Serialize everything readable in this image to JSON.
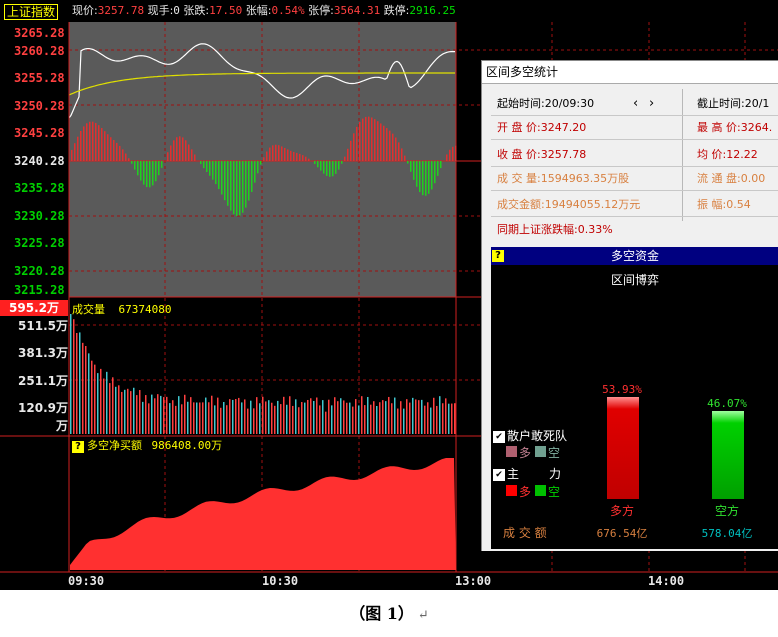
{
  "topbar": {
    "index_name": "上证指数",
    "now_label": "现价:",
    "now_value": "3257.78",
    "hand_label": "现手:",
    "hand_value": "0",
    "change_label": "张跌:",
    "change_value": "17.50",
    "pct_label": "张幅:",
    "pct_value": "0.54%",
    "limit_up_label": "张停:",
    "limit_up_value": "3564.31",
    "limit_down_label": "跌停:",
    "limit_down_value": "2916.25"
  },
  "price_axis": {
    "red_labels": [
      "3265.28",
      "3260.28",
      "3255.28",
      "3250.28",
      "3245.28"
    ],
    "mid_label": "3240.28",
    "green_labels": [
      "3235.28",
      "3230.28",
      "3225.28",
      "3220.28",
      "3215.28"
    ]
  },
  "volume": {
    "max_label": "595.2万",
    "title": "成交量",
    "value": "67374080",
    "axis_labels": [
      "511.5万",
      "381.3万",
      "251.1万",
      "120.9万",
      "万"
    ]
  },
  "net_buy": {
    "title": "多空净买额",
    "value": "986408.00万"
  },
  "time_axis": [
    "09:30",
    "10:30",
    "13:00",
    "14:00"
  ],
  "popup": {
    "title": "区间多空统计",
    "start_label": "起始时间:20/09:30",
    "nav_prev": "‹",
    "nav_next": "›",
    "end_label": "截止时间:20/1",
    "open_label": "开 盘 价:3247.20",
    "high_label": "最 高 价:3264.",
    "close_label": "收 盘 价:3257.78",
    "avg_label": "均    价:12.22",
    "volume_label": "成 交 量:1594963.35万股",
    "float_label": "流 通 盘:0.00",
    "amount_label": "成交金额:19494055.12万元",
    "amplitude_label": "振    幅:0.54",
    "period_change": "同期上证涨跌幅:0.33%",
    "panel": {
      "header": "多空资金",
      "subtitle": "区间博弈",
      "legend_retail": "散户敢死队",
      "legend_main": "主",
      "legend_main_power": "力",
      "duo": "多",
      "kong": "空",
      "long_pct": "53.93%",
      "short_pct": "46.07%",
      "long_label": "多方",
      "short_label": "空方",
      "amount_title": "成 交 额",
      "long_amount": "676.54亿",
      "short_amount": "578.04亿"
    }
  },
  "caption": "（图 1）",
  "caption_mark": "↵",
  "colors": {
    "up": "#ff4040",
    "down": "#00d000",
    "price_line": "#ffffff",
    "avg_line": "#e0e000",
    "long_bar": "#e00000",
    "short_bar": "#00c000"
  }
}
